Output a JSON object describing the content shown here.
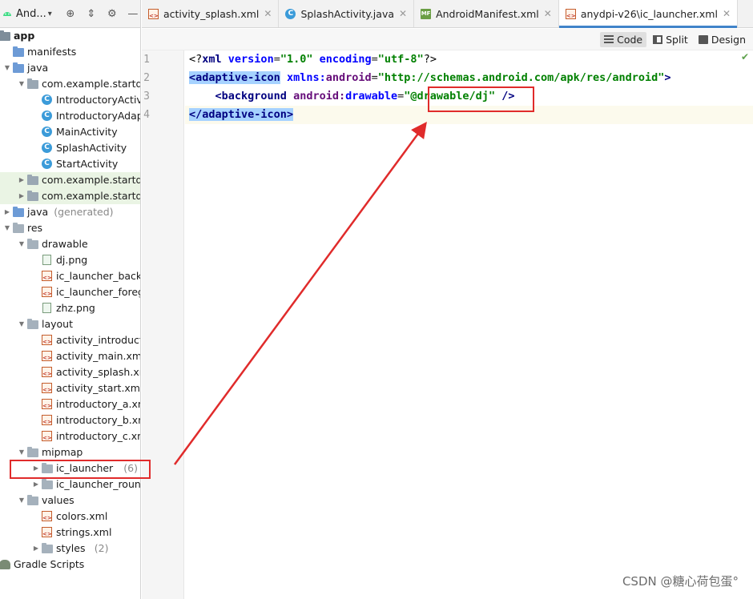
{
  "project": {
    "view_label": "And...",
    "tree": [
      {
        "label": "app",
        "bold": true,
        "icon": "module-icon"
      },
      {
        "label": "manifests",
        "icon": "folder-icon"
      },
      {
        "label": "java",
        "icon": "folder-icon"
      },
      {
        "label": "com.example.startdem",
        "icon": "package-icon"
      },
      {
        "label": "IntroductoryActivit",
        "icon": "class-icon"
      },
      {
        "label": "IntroductoryAdapt",
        "icon": "class-icon"
      },
      {
        "label": "MainActivity",
        "icon": "class-icon"
      },
      {
        "label": "SplashActivity",
        "icon": "class-icon"
      },
      {
        "label": "StartActivity",
        "icon": "class-icon"
      },
      {
        "label": "com.example.startdem",
        "icon": "package-icon"
      },
      {
        "label": "com.example.startdem",
        "icon": "package-icon"
      },
      {
        "label": "java",
        "suffix": "(generated)",
        "icon": "folder-icon"
      },
      {
        "label": "res",
        "icon": "folder-icon"
      },
      {
        "label": "drawable",
        "icon": "folder-icon"
      },
      {
        "label": "dj.png",
        "icon": "png-file-icon"
      },
      {
        "label": "ic_launcher_backg",
        "icon": "xml-file-icon"
      },
      {
        "label": "ic_launcher_foregr",
        "icon": "xml-file-icon"
      },
      {
        "label": "zhz.png",
        "icon": "png-file-icon"
      },
      {
        "label": "layout",
        "icon": "folder-icon"
      },
      {
        "label": "activity_introducto",
        "icon": "xml-file-icon"
      },
      {
        "label": "activity_main.xml",
        "icon": "xml-file-icon"
      },
      {
        "label": "activity_splash.xml",
        "icon": "xml-file-icon"
      },
      {
        "label": "activity_start.xml",
        "icon": "xml-file-icon"
      },
      {
        "label": "introductory_a.xml",
        "icon": "xml-file-icon"
      },
      {
        "label": "introductory_b.xml",
        "icon": "xml-file-icon"
      },
      {
        "label": "introductory_c.xml",
        "icon": "xml-file-icon"
      },
      {
        "label": "mipmap",
        "icon": "folder-icon"
      },
      {
        "label": "ic_launcher",
        "suffix": "(6)",
        "icon": "folder-icon"
      },
      {
        "label": "ic_launcher_round",
        "icon": "folder-icon"
      },
      {
        "label": "values",
        "icon": "folder-icon"
      },
      {
        "label": "colors.xml",
        "icon": "xml-file-icon"
      },
      {
        "label": "strings.xml",
        "icon": "xml-file-icon"
      },
      {
        "label": "styles",
        "suffix": "(2)",
        "icon": "folder-icon"
      },
      {
        "label": "Gradle Scripts",
        "icon": "gradle-icon"
      }
    ]
  },
  "tabs": [
    {
      "label": "activity_splash.xml",
      "icon": "xml-file-icon"
    },
    {
      "label": "SplashActivity.java",
      "icon": "class-icon"
    },
    {
      "label": "AndroidManifest.xml",
      "icon": "manifest-icon"
    },
    {
      "label": "anydpi-v26\\ic_launcher.xml",
      "icon": "xml-file-icon"
    }
  ],
  "view_modes": {
    "code": "Code",
    "split": "Split",
    "design": "Design"
  },
  "line_numbers": [
    "1",
    "2",
    "3",
    "4"
  ],
  "code": {
    "l1": {
      "open": "<?",
      "tag": "xml",
      "a1": "version",
      "v1": "\"1.0\"",
      "a2": "encoding",
      "v2": "\"utf-8\"",
      "close": "?>"
    },
    "l2": {
      "open": "<",
      "tag": "adaptive-icon",
      "ns": "xmlns:",
      "attr": "android",
      "eq": "=",
      "val": "\"http://schemas.android.com/apk/res/android\"",
      "close": ">"
    },
    "l3": {
      "indent": "    ",
      "open": "<",
      "tag": "background",
      "ns": "android:",
      "attr": "drawable",
      "eq": "=",
      "val": "\"@drawable/dj\"",
      "close": " />"
    },
    "l4": {
      "open": "</",
      "tag": "adaptive-icon",
      "close": ">"
    }
  },
  "watermark": "CSDN @糖心荷包蛋°",
  "colors": {
    "highlight_box": "#e02b2b",
    "tab_underline": "#4083c9",
    "selection": "#a6d2ff"
  }
}
